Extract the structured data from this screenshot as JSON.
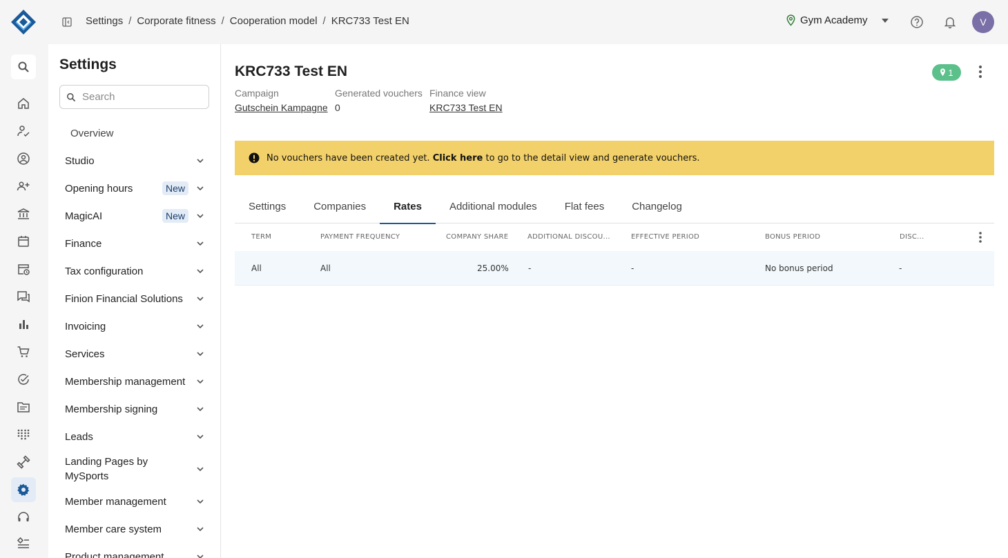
{
  "breadcrumb": [
    "Settings",
    "Corporate fitness",
    "Cooperation model",
    "KRC733 Test EN"
  ],
  "tenant": "Gym Academy",
  "user_initial": "V",
  "rail_icons": [
    "search-icon",
    "home-icon",
    "member-check-icon",
    "person-circle-icon",
    "add-people-icon",
    "bank-icon",
    "calendar-icon",
    "calendar-clock-icon",
    "chat-icon",
    "bar-chart-icon",
    "cart-icon",
    "check-circle-icon",
    "document-icon",
    "dots-grid-icon",
    "dumbbell-icon",
    "settings-icon",
    "headset-icon",
    "widgets-icon"
  ],
  "settings": {
    "title": "Settings",
    "search_placeholder": "Search",
    "overview": "Overview",
    "items": [
      {
        "label": "Studio",
        "badge": ""
      },
      {
        "label": "Opening hours",
        "badge": "New"
      },
      {
        "label": "MagicAI",
        "badge": "New"
      },
      {
        "label": "Finance",
        "badge": ""
      },
      {
        "label": "Tax configuration",
        "badge": ""
      },
      {
        "label": "Finion Financial Solutions",
        "badge": ""
      },
      {
        "label": "Invoicing",
        "badge": ""
      },
      {
        "label": "Services",
        "badge": ""
      },
      {
        "label": "Membership management",
        "badge": ""
      },
      {
        "label": "Membership signing",
        "badge": ""
      },
      {
        "label": "Leads",
        "badge": ""
      },
      {
        "label": "Landing Pages by MySports",
        "badge": ""
      },
      {
        "label": "Member management",
        "badge": ""
      },
      {
        "label": "Member care system",
        "badge": ""
      },
      {
        "label": "Product management",
        "badge": ""
      }
    ]
  },
  "main": {
    "title": "KRC733 Test EN",
    "pin_count": "1",
    "campaign_label": "Campaign",
    "campaign_value": "Gutschein Kampagne",
    "vouchers_label": "Generated vouchers",
    "vouchers_value": "0",
    "finance_label": "Finance view",
    "finance_value": "KRC733 Test EN",
    "alert_text_1": "No vouchers have been created yet.",
    "alert_link": "Click here",
    "alert_text_2": "to go to the detail view and generate vouchers.",
    "tabs": [
      "Settings",
      "Companies",
      "Rates",
      "Additional modules",
      "Flat fees",
      "Changelog"
    ],
    "active_tab": "Rates",
    "columns": [
      "TERM",
      "PAYMENT FREQUENCY",
      "COMPANY SHARE",
      "ADDITIONAL DISCOU...",
      "EFFECTIVE PERIOD",
      "BONUS PERIOD",
      "DISC..."
    ],
    "rows": [
      [
        "All",
        "All",
        "25.00%",
        "-",
        "-",
        "No bonus period",
        "-"
      ]
    ]
  },
  "colors": {
    "accent": "#1a5a99",
    "alert": "#f3d16a",
    "badge_green": "#5cc08b",
    "avatar": "#7a6fa6"
  }
}
